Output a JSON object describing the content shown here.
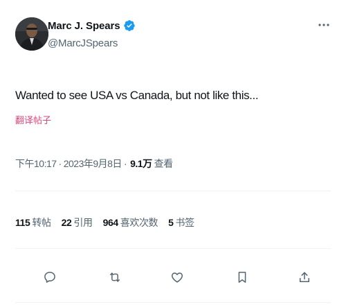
{
  "author": {
    "display_name": "Marc J. Spears",
    "handle": "@MarcJSpears",
    "verified_icon": "verified-badge-icon",
    "accent_color": "#1d9bf0"
  },
  "tweet": {
    "text": "Wanted to see USA vs Canada, but not like this...",
    "translate_label": "翻译帖子"
  },
  "meta": {
    "time": "下午10:17",
    "separator": "·",
    "date": "2023年9月8日",
    "views_count": "9.1万",
    "views_label": "查看"
  },
  "stats": {
    "retweets": {
      "count": "115",
      "label": "转帖"
    },
    "quotes": {
      "count": "22",
      "label": "引用"
    },
    "likes": {
      "count": "964",
      "label": "喜欢次数"
    },
    "bookmarks": {
      "count": "5",
      "label": "书签"
    }
  },
  "actions": [
    "reply-icon",
    "retweet-icon",
    "like-icon",
    "bookmark-icon",
    "share-icon"
  ]
}
